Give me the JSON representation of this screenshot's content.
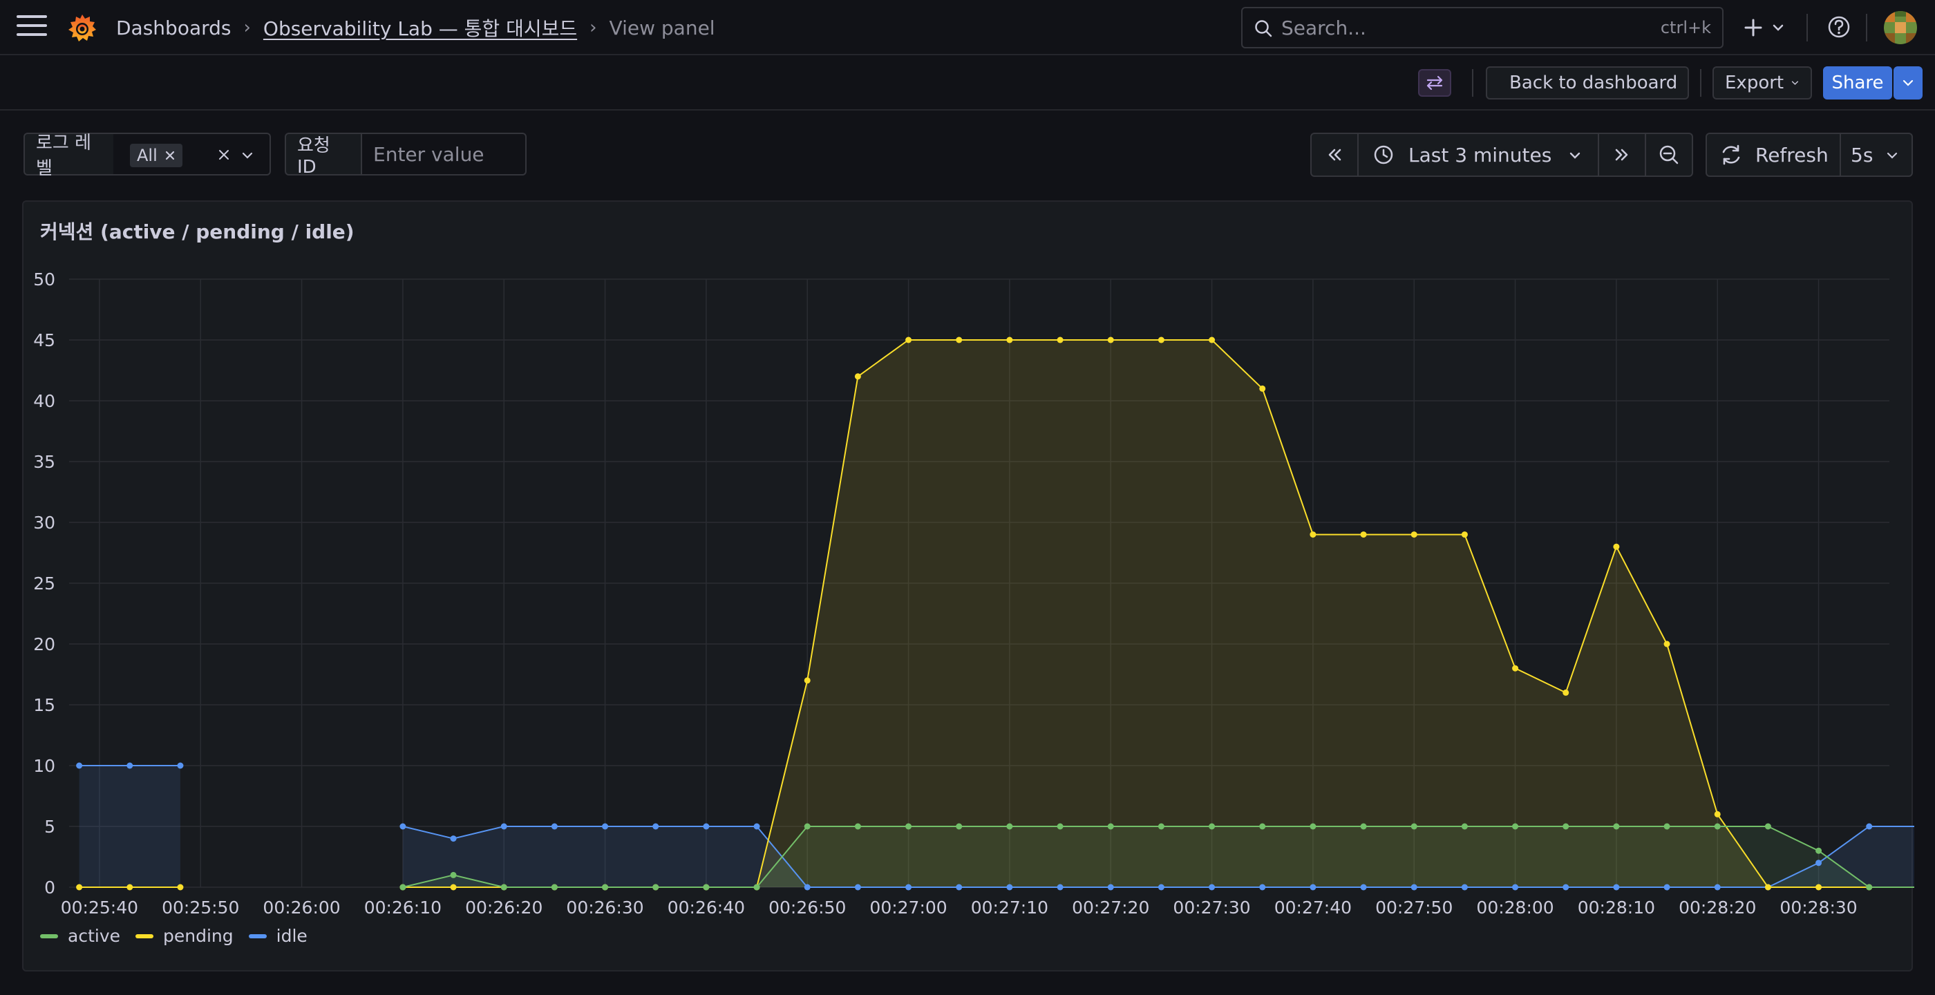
{
  "header": {
    "breadcrumb": [
      "Dashboards",
      "Observability Lab — 통합 대시보드",
      "View panel"
    ],
    "search_placeholder": "Search...",
    "search_shortcut": "ctrl+k"
  },
  "toolbar": {
    "back_label": "Back to dashboard",
    "export_label": "Export",
    "share_label": "Share"
  },
  "variables": {
    "log_level_label": "로그 레벨",
    "log_level_value": "All",
    "request_id_label": "요청 ID",
    "request_id_placeholder": "Enter value"
  },
  "time_picker": {
    "range_label": "Last 3 minutes",
    "refresh_label": "Refresh",
    "refresh_interval": "5s"
  },
  "panel": {
    "title": "커넥션 (active / pending / idle)"
  },
  "colors": {
    "active": "#73bf69",
    "pending": "#fade2a",
    "idle": "#5794f2",
    "accent": "#3d71d9"
  },
  "chart_data": {
    "type": "line",
    "title": "커넥션 (active / pending / idle)",
    "ylim": [
      0,
      50
    ],
    "yticks": [
      0,
      5,
      10,
      15,
      20,
      25,
      30,
      35,
      40,
      45,
      50
    ],
    "x_tick_labels": [
      "00:25:40",
      "00:25:50",
      "00:26:00",
      "00:26:10",
      "00:26:20",
      "00:26:30",
      "00:26:40",
      "00:26:50",
      "00:27:00",
      "00:27:10",
      "00:27:20",
      "00:27:30",
      "00:27:40",
      "00:27:50",
      "00:28:00",
      "00:28:10",
      "00:28:20",
      "00:28:30"
    ],
    "x_range": [
      "00:25:37",
      "00:28:37"
    ],
    "x_sample_interval_seconds": 5,
    "legend_position": "bottom-left",
    "grid": true,
    "series": [
      {
        "name": "active",
        "segments": [
          {
            "start": "00:26:10",
            "values": [
              0,
              1,
              0,
              0,
              0,
              0,
              0,
              0,
              5,
              5,
              5,
              5,
              5,
              5,
              5,
              5,
              5,
              5,
              5,
              5,
              5,
              5,
              5,
              5,
              5,
              5,
              5,
              5,
              3,
              0,
              0,
              0
            ]
          }
        ]
      },
      {
        "name": "pending",
        "segments": [
          {
            "start": "00:25:38",
            "values": [
              0,
              0,
              0
            ]
          },
          {
            "start": "00:26:10",
            "values": [
              0,
              0,
              0,
              0,
              0,
              0,
              0,
              0,
              17,
              42,
              45,
              45,
              45,
              45,
              45,
              45,
              45,
              41,
              29,
              29,
              29,
              29,
              18,
              16,
              28,
              20,
              6,
              0,
              0,
              0,
              0,
              0
            ]
          }
        ]
      },
      {
        "name": "idle",
        "segments": [
          {
            "start": "00:25:38",
            "values": [
              10,
              10,
              10
            ]
          },
          {
            "start": "00:26:10",
            "values": [
              5,
              4,
              5,
              5,
              5,
              5,
              5,
              5,
              0,
              0,
              0,
              0,
              0,
              0,
              0,
              0,
              0,
              0,
              0,
              0,
              0,
              0,
              0,
              0,
              0,
              0,
              0,
              0,
              2,
              5,
              5,
              5
            ]
          }
        ]
      }
    ]
  }
}
